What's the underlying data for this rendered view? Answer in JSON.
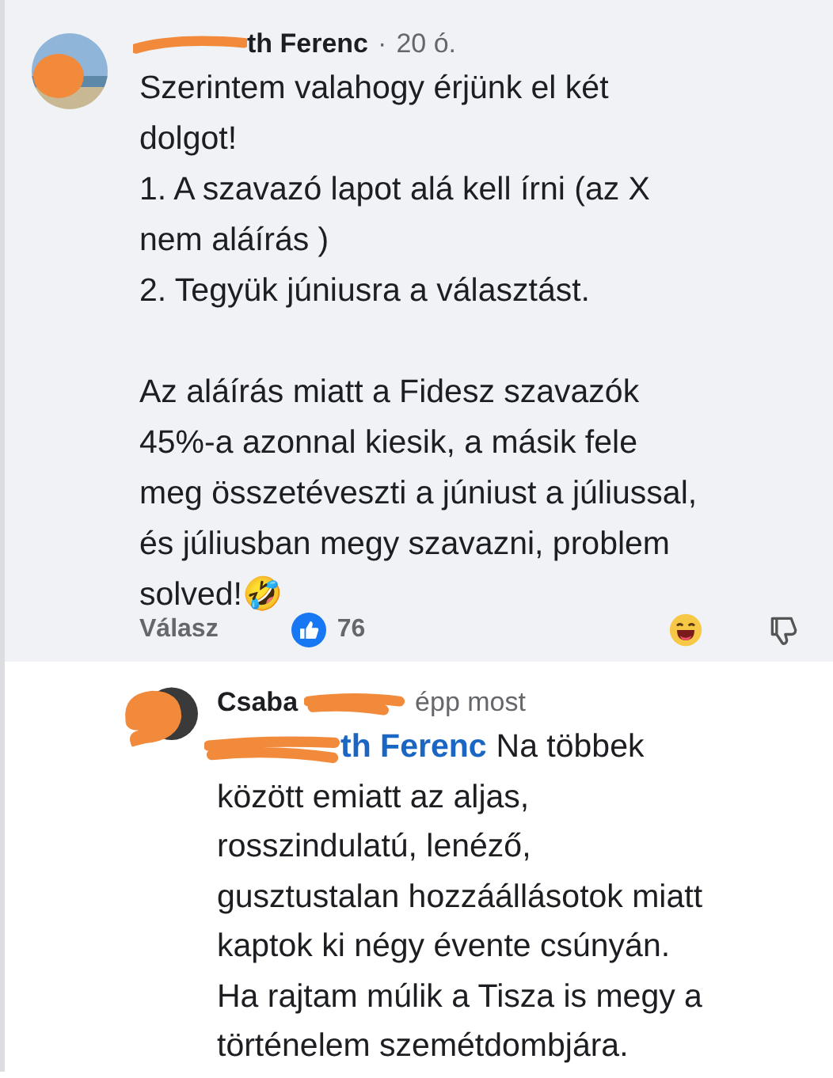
{
  "comment": {
    "author": "th Ferenc",
    "author_redacted": true,
    "separator": "·",
    "time": "20 ó.",
    "paragraphs": [
      [
        "Szerintem valahogy érjünk el két",
        "dolgot!",
        "1. A szavazó lapot alá kell írni (az X",
        "nem aláírás )",
        "2. Tegyük júniusra a választást."
      ],
      [
        "Az aláírás miatt a Fidesz szavazók",
        "45%-a azonnal kiesik, a másik fele",
        "meg összetéveszti a júniust a júliussal,",
        "és júliusban megy szavazni, problem",
        "solved!🤣"
      ]
    ],
    "reply_label": "Válasz",
    "like_count": "76"
  },
  "reply": {
    "author": "Csaba",
    "author_redacted": true,
    "time": "épp most",
    "mention": "th Ferenc",
    "mention_redacted": true,
    "lines": [
      "Na többek",
      "között emiatt az aljas,",
      "rosszindulatú, lenéző,",
      "gusztustalan hozzáállásotok miatt",
      "kaptok ki négy évente csúnyán.",
      "Ha rajtam múlik a Tisza is megy a",
      "történelem szemétdombjára."
    ]
  }
}
